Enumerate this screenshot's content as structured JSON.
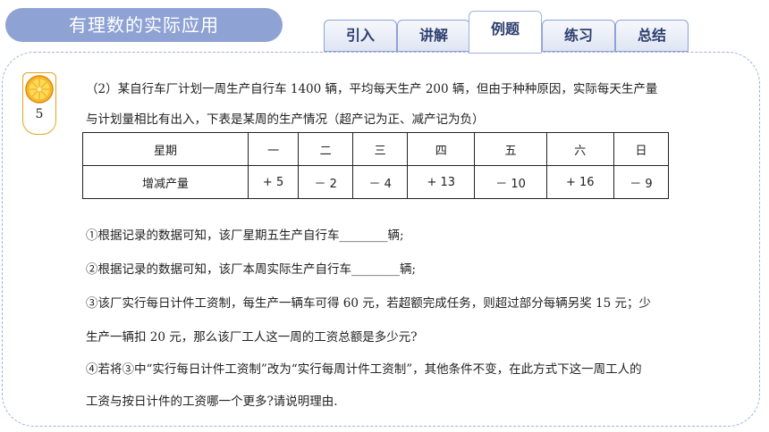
{
  "header": {
    "title": "有理数的实际应用"
  },
  "tabs": [
    {
      "label": "引入",
      "active": false
    },
    {
      "label": "讲解",
      "active": false
    },
    {
      "label": "例题",
      "active": true
    },
    {
      "label": "练习",
      "active": false
    },
    {
      "label": "总结",
      "active": false
    }
  ],
  "badge": {
    "number": "5",
    "icon": "orange-slice-icon"
  },
  "problem": {
    "intro_line1": "（2）某自行车厂计划一周生产自行车 1400 辆，平均每天生产 200 辆，但由于种种原因，实际每天生产量",
    "intro_line2": "与计划量相比有出入，下表是某周的生产情况（超产记为正、减产记为负）",
    "table": {
      "header": [
        "星期",
        "一",
        "二",
        "三",
        "四",
        "五",
        "六",
        "日"
      ],
      "row": [
        "增减产量",
        "+ 5",
        "－ 2",
        "－ 4",
        "+ 13",
        "－ 10",
        "+ 16",
        "－ 9"
      ]
    },
    "q1": "①根据记录的数据可知，该厂星期五生产自行车________辆;",
    "q2": "②根据记录的数据可知，该厂本周实际生产自行车________辆;",
    "q3_line1": "③该厂实行每日计件工资制，每生产一辆车可得 60 元，若超额完成任务，则超过部分每辆另奖 15 元；少",
    "q3_line2": "生产一辆扣 20 元，那么该厂工人这一周的工资总额是多少元?",
    "q4_line1": "④若将③中“实行每日计件工资制”改为“实行每周计件工资制”，其他条件不变，在此方式下这一周工人的",
    "q4_line2": "工资与按日计件的工资哪一个更多?请说明理由."
  },
  "colors": {
    "title_bg": "#8fa2d4",
    "tab_text": "#2d3e6f",
    "badge_border": "#e6a21f",
    "orange": "#f5b82a"
  }
}
